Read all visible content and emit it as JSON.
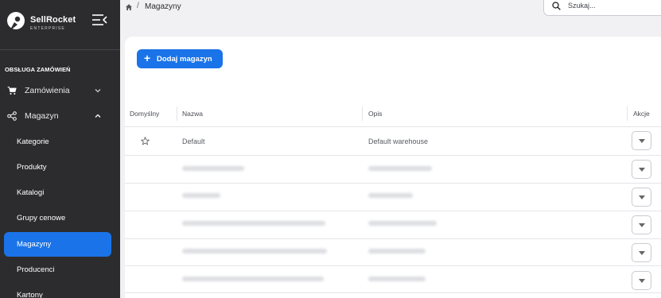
{
  "brand": {
    "name": "SellRocket",
    "subtitle": "ENTERPRISE"
  },
  "sidebar": {
    "section_title": "OBSŁUGA ZAMÓWIEŃ",
    "items": [
      {
        "label": "Zamówienia",
        "icon": "cart-icon",
        "chevron": "chevron-down-icon"
      },
      {
        "label": "Magazyn",
        "icon": "share-nodes-icon",
        "chevron": "chevron-up-icon"
      }
    ],
    "subitems": [
      "Kategorie",
      "Produkty",
      "Katalogi",
      "Grupy cenowe",
      "Magazyny",
      "Producenci",
      "Kartony"
    ],
    "active_subitem": "Magazyny",
    "accent_color": "#1a73e8",
    "background": "#2c2c2f"
  },
  "breadcrumb": {
    "home_icon": "home-icon",
    "separator": "/",
    "current": "Magazyny"
  },
  "search": {
    "placeholder": "Szukaj..."
  },
  "toolbar": {
    "add_label": "Dodaj magazyn"
  },
  "table": {
    "columns": [
      "Domyślny",
      "Nazwa",
      "Opis",
      "Akcje"
    ],
    "rows": [
      {
        "default": true,
        "name": "Default",
        "description": "Default warehouse"
      },
      {
        "default": false,
        "name": "",
        "description": ""
      },
      {
        "default": false,
        "name": "",
        "description": ""
      },
      {
        "default": false,
        "name": "",
        "description": ""
      },
      {
        "default": false,
        "name": "",
        "description": ""
      },
      {
        "default": false,
        "name": "",
        "description": ""
      }
    ]
  }
}
